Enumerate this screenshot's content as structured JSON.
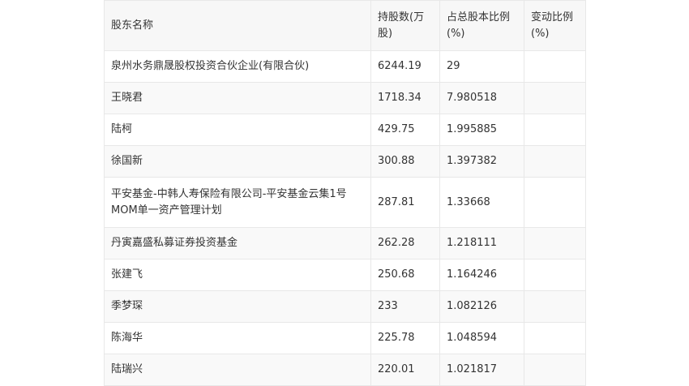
{
  "table": {
    "headers": [
      "股东名称",
      "持股数(万股)",
      "占总股本比例(%)",
      "变动比例(%)"
    ],
    "rows": [
      [
        "泉州水务鼎晟股权投资合伙企业(有限合伙)",
        "6244.19",
        "29",
        ""
      ],
      [
        "王晓君",
        "1718.34",
        "7.980518",
        ""
      ],
      [
        "陆柯",
        "429.75",
        "1.995885",
        ""
      ],
      [
        "徐国新",
        "300.88",
        "1.397382",
        ""
      ],
      [
        "平安基金-中韩人寿保险有限公司-平安基金云集1号MOM单一资产管理计划",
        "287.81",
        "1.33668",
        ""
      ],
      [
        "丹寅嘉盛私募证券投资基金",
        "262.28",
        "1.218111",
        ""
      ],
      [
        "张建飞",
        "250.68",
        "1.164246",
        ""
      ],
      [
        "季梦琛",
        "233",
        "1.082126",
        ""
      ],
      [
        "陈海华",
        "225.78",
        "1.048594",
        ""
      ],
      [
        "陆瑞兴",
        "220.01",
        "1.021817",
        ""
      ]
    ]
  }
}
